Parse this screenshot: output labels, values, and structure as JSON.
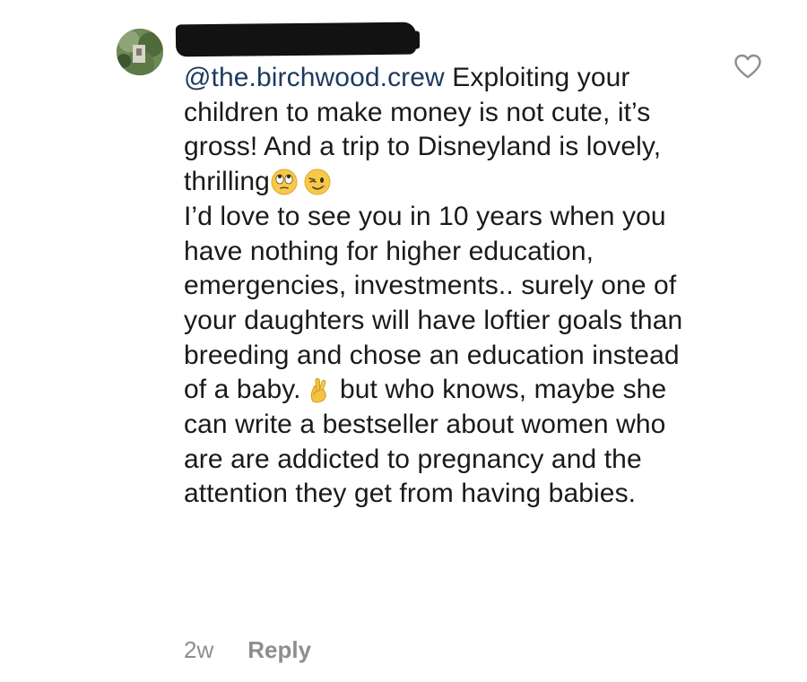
{
  "comment": {
    "mention": "@the.birchwood.crew",
    "segment_1": " Exploiting your children to make money is not cute, it’s gross! And a trip to Disneyland is lovely, thrilling",
    "segment_2": "I’d love to see you in 10 years when you have nothing for higher education, emergencies, investments.. surely one of your daughters will have loftier goals than breeding and chose an education instead of a baby.",
    "segment_3": " but who knows, maybe she can write a bestseller about women who are are addicted to pregnancy and the attention they get from having babies.",
    "emojis": [
      "eye-roll-emoji",
      "wink-emoji",
      "crossed-fingers-emoji"
    ]
  },
  "meta": {
    "timestamp": "2w",
    "reply_label": "Reply"
  },
  "colors": {
    "text": "#1a1a1a",
    "mention": "#1c3a5e",
    "meta": "#8e8e8e",
    "emoji_yellow": "#f7c948"
  },
  "icons": {
    "like": "heart-outline-icon"
  }
}
